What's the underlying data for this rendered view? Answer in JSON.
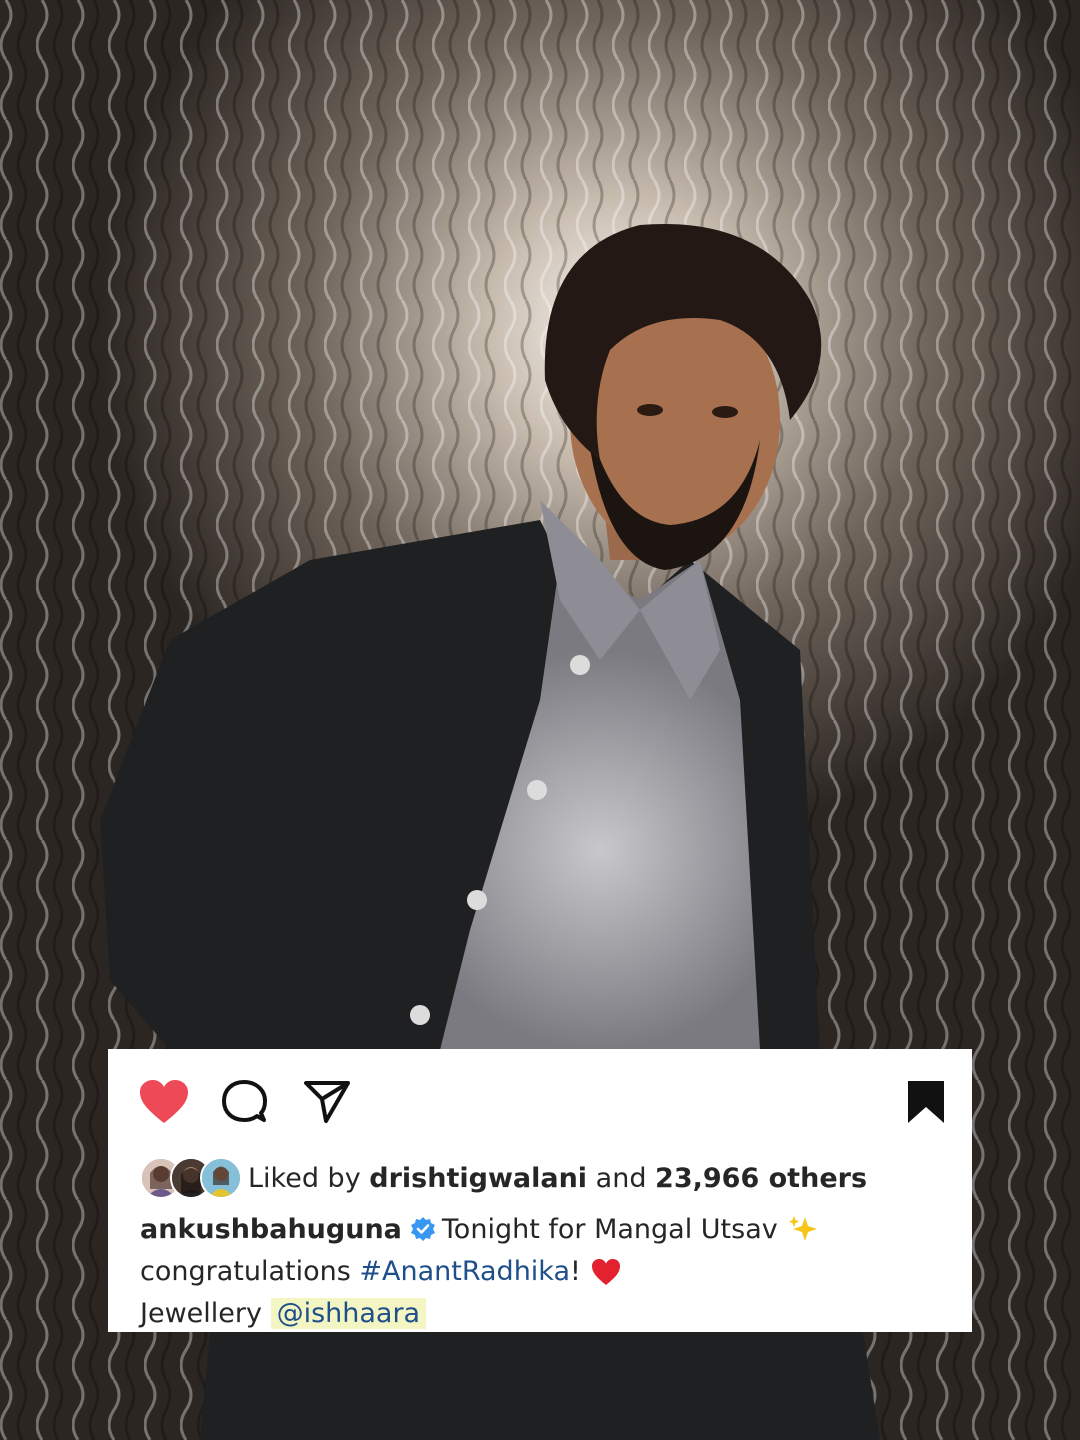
{
  "post": {
    "actions": {
      "like_icon": "heart-filled-icon",
      "comment_icon": "comment-icon",
      "share_icon": "send-icon",
      "save_icon": "bookmark-filled-icon",
      "like_color": "#ed4956"
    },
    "likes": {
      "prefix": "Liked by",
      "user": "drishtigwalani",
      "joiner": "and",
      "others": "23,966 others"
    },
    "caption": {
      "username": "ankushbahuguna",
      "verified_icon": "verified-badge-icon",
      "line1": "Tonight for Mangal Utsav",
      "line1_emoji": "sparkles-icon",
      "line2_prefix": "congratulations",
      "hashtag": "#AnantRadhika",
      "line2_suffix": "!",
      "line2_emoji": "red-heart-icon",
      "line3_prefix": "Jewellery",
      "mention": "@ishhaara"
    }
  }
}
